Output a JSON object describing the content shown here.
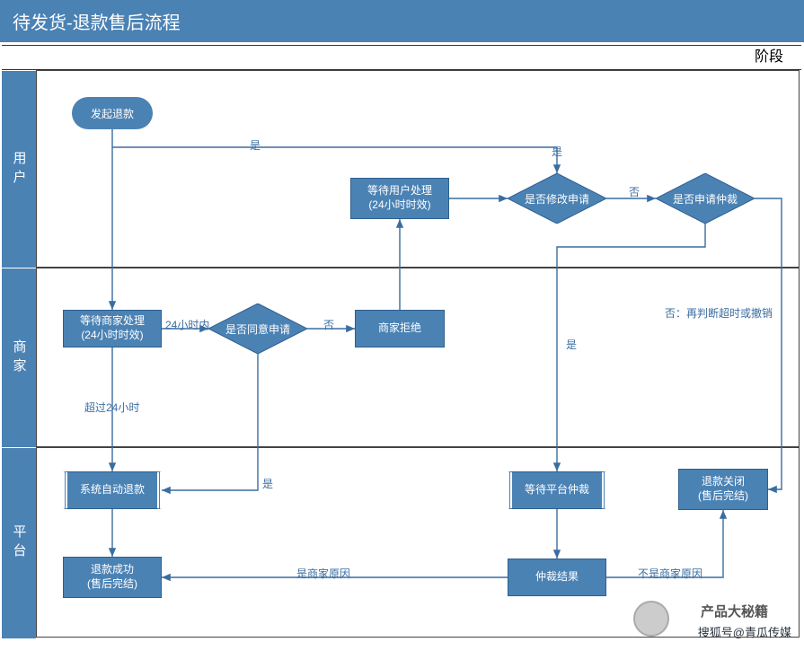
{
  "title": "待发货-退款售后流程",
  "stage_label": "阶段",
  "lanes": {
    "user": "用户",
    "merchant": "商家",
    "platform": "平台"
  },
  "nodes": {
    "start": "发起退款",
    "wait_merchant": "等待商家处理\n(24小时时效)",
    "agree": "是否同意申请",
    "merchant_reject": "商家拒绝",
    "wait_user": "等待用户处理\n(24小时时效)",
    "modify": "是否修改申请",
    "arbitrate_ask": "是否申请仲裁",
    "auto_refund": "系统自动退款",
    "refund_success": "退款成功\n(售后完结)",
    "wait_platform": "等待平台仲裁",
    "arbitrate_result": "仲裁结果",
    "refund_close": "退款关闭\n(售后完结)"
  },
  "edges": {
    "yes1": "是",
    "within24": "24小时内",
    "no_agree": "否",
    "over24": "超过24小时",
    "agree_yes": "是",
    "modify_no": "否",
    "modify_yes": "是",
    "arb_yes": "是",
    "arb_no": "否：再判断超时或撤销",
    "is_merchant_cause": "是商家原因",
    "not_merchant_cause": "不是商家原因"
  },
  "watermark": {
    "title": "产品大秘籍",
    "sub": "搜狐号@青瓜传媒"
  }
}
